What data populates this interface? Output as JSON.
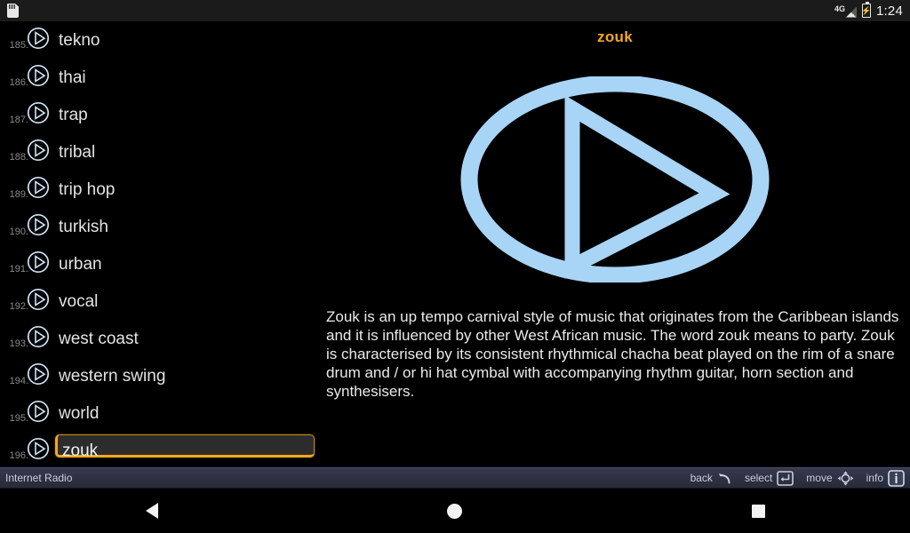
{
  "status_bar": {
    "sd_icon": "sd-card-icon",
    "network_label": "4G",
    "battery_icon": "battery-charging-icon",
    "clock": "1:24"
  },
  "list": {
    "rows": [
      {
        "index": "185.",
        "label": "tekno",
        "selected": false
      },
      {
        "index": "186.",
        "label": "thai",
        "selected": false
      },
      {
        "index": "187.",
        "label": "trap",
        "selected": false
      },
      {
        "index": "188.",
        "label": "tribal",
        "selected": false
      },
      {
        "index": "189.",
        "label": "trip hop",
        "selected": false
      },
      {
        "index": "190.",
        "label": "turkish",
        "selected": false
      },
      {
        "index": "191.",
        "label": "urban",
        "selected": false
      },
      {
        "index": "192.",
        "label": "vocal",
        "selected": false
      },
      {
        "index": "193.",
        "label": "west coast",
        "selected": false
      },
      {
        "index": "194.",
        "label": "western swing",
        "selected": false
      },
      {
        "index": "195.",
        "label": "world",
        "selected": false
      },
      {
        "index": "196.",
        "label": "zouk",
        "selected": true
      }
    ]
  },
  "detail": {
    "title": "zouk",
    "logo_icon": "play-circle-logo",
    "description": "Zouk is an up tempo carnival style of music that originates from the Caribbean islands and it is influenced by other West African music. The word zouk means to party. Zouk is characterised by its consistent rhythmical chacha beat played on the rim of a snare drum and / or hi hat cymbal with accompanying rhythm guitar, horn section and synthesisers."
  },
  "softkeys": {
    "app_name": "Internet Radio",
    "hints": [
      {
        "label": "back",
        "icon": "undo-arrow-icon"
      },
      {
        "label": "select",
        "icon": "enter-key-icon"
      },
      {
        "label": "move",
        "icon": "dpad-move-icon"
      },
      {
        "label": "info",
        "icon": "info-badge-icon"
      }
    ]
  },
  "nav_bar": {
    "back": "back-triangle-icon",
    "home": "home-circle-icon",
    "recents": "recents-square-icon"
  },
  "colors": {
    "accent_orange": "#f5a623",
    "logo_blue": "#a8d4f5",
    "bar_slate": "#2a2e3e"
  }
}
